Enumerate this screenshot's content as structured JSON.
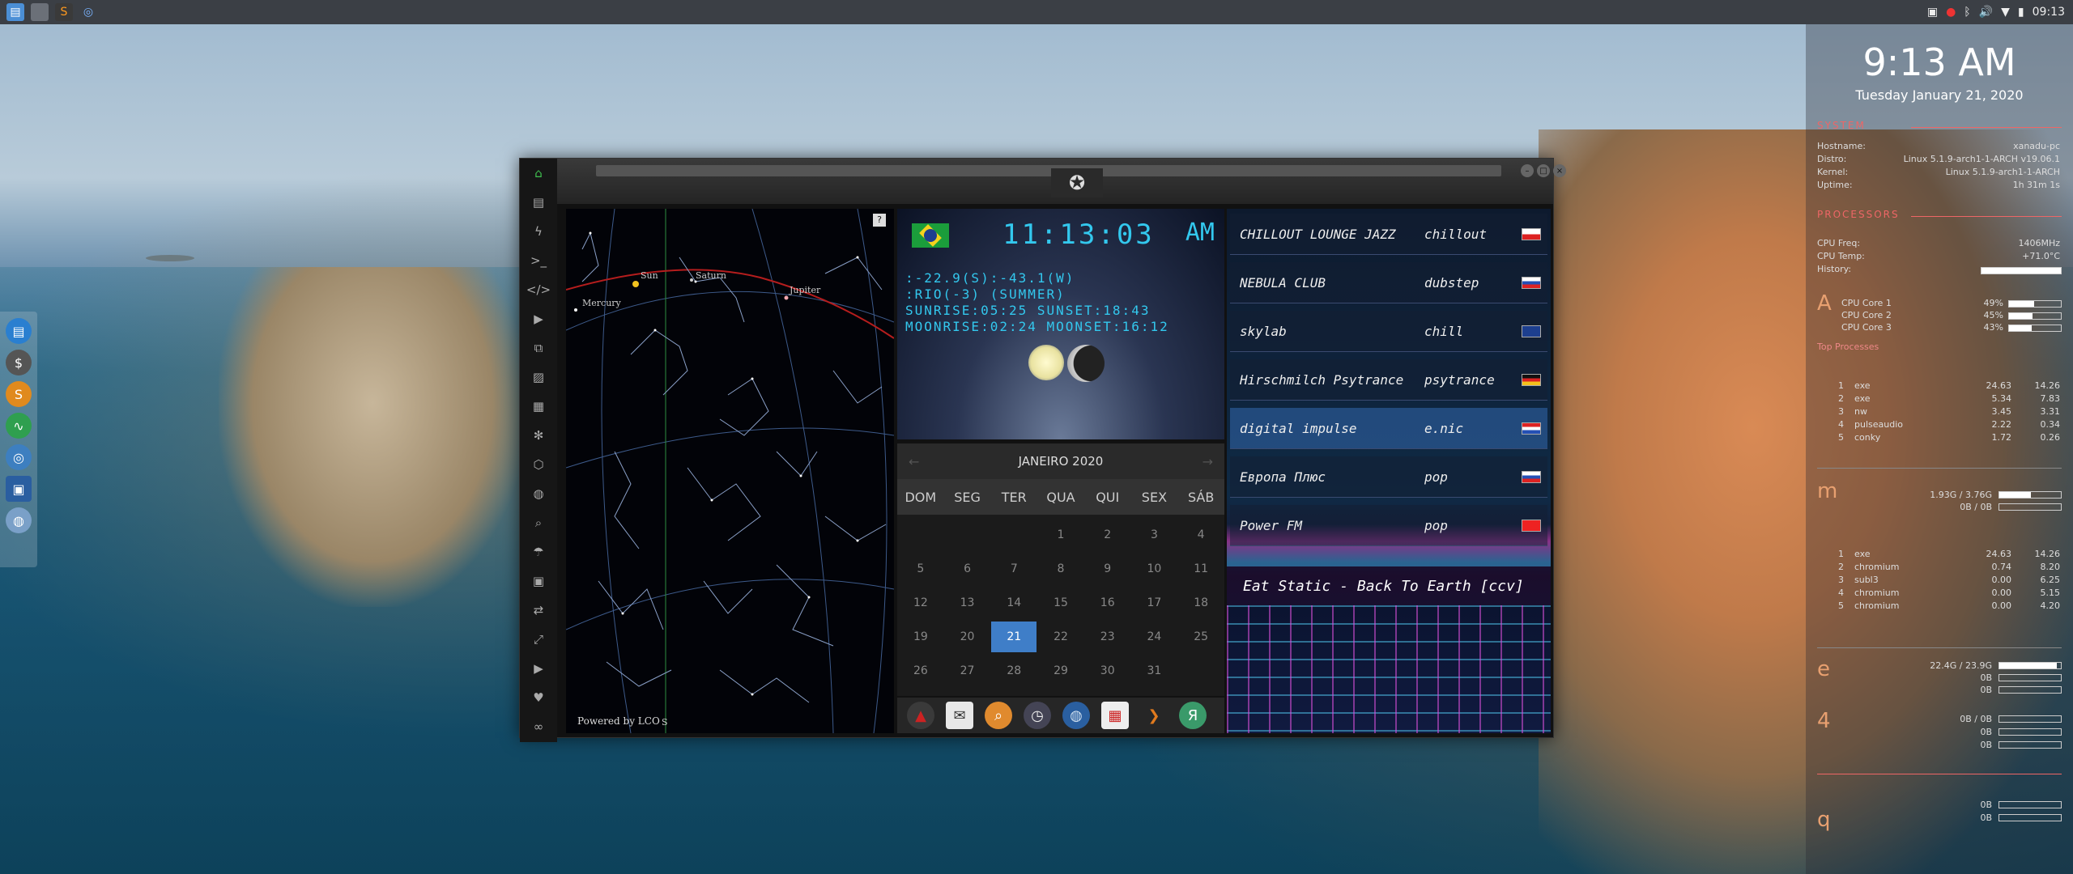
{
  "topbar": {
    "tray_time": "09:13",
    "left_icons": [
      "files-icon",
      "blank-icon",
      "sublime-icon",
      "chrome-icon"
    ]
  },
  "left_dock": {
    "icons": [
      "files-icon",
      "money-icon",
      "s-icon",
      "pulse-icon",
      "chrome-icon",
      "screenshot-icon",
      "globe-icon"
    ]
  },
  "conky": {
    "time": "9:13 AM",
    "date": "Tuesday January 21, 2020",
    "system": {
      "heading": "SYSTEM",
      "rows": [
        {
          "label": "Hostname:",
          "value": "xanadu-pc"
        },
        {
          "label": "Distro:",
          "value": "Linux 5.1.9-arch1-1-ARCH v19.06.1"
        },
        {
          "label": "Kernel:",
          "value": "Linux 5.1.9-arch1-1-ARCH"
        },
        {
          "label": "Uptime:",
          "value": "1h 31m 1s"
        }
      ]
    },
    "processors": {
      "heading": "PROCESSORS",
      "rows": [
        {
          "label": "CPU Freq:",
          "value": "1406MHz"
        },
        {
          "label": "CPU Temp:",
          "value": "+71.0°C"
        },
        {
          "label": "History:",
          "value": ""
        }
      ],
      "cores": [
        {
          "label": "CPU Core 1",
          "value": "49%",
          "pct": 49
        },
        {
          "label": "CPU Core 2",
          "value": "45%",
          "pct": 45
        },
        {
          "label": "CPU Core 3",
          "value": "43%",
          "pct": 43
        }
      ],
      "top_heading": "Top Processes",
      "top": [
        {
          "n": "1",
          "name": "exe",
          "a": "24.63",
          "b": "14.26"
        },
        {
          "n": "2",
          "name": "exe",
          "a": "5.34",
          "b": "7.83"
        },
        {
          "n": "3",
          "name": "nw",
          "a": "3.45",
          "b": "3.31"
        },
        {
          "n": "4",
          "name": "pulseaudio",
          "a": "2.22",
          "b": "0.34"
        },
        {
          "n": "5",
          "name": "conky",
          "a": "1.72",
          "b": "0.26"
        }
      ]
    },
    "memory": {
      "big": "m",
      "ram": "1.93G / 3.76G",
      "swap": "0B / 0B",
      "ram_pct": 51,
      "top": [
        {
          "n": "1",
          "name": "exe",
          "a": "24.63",
          "b": "14.26"
        },
        {
          "n": "2",
          "name": "chromium",
          "a": "0.74",
          "b": "8.20"
        },
        {
          "n": "3",
          "name": "subl3",
          "a": "0.00",
          "b": "6.25"
        },
        {
          "n": "4",
          "name": "chromium",
          "a": "0.00",
          "b": "5.15"
        },
        {
          "n": "5",
          "name": "chromium",
          "a": "0.00",
          "b": "4.20"
        }
      ]
    },
    "storage": {
      "big": "e",
      "root": "22.4G / 23.9G",
      "root_pct": 94,
      "rows": [
        "0B",
        "0B"
      ]
    },
    "network": {
      "big": "4",
      "rows": [
        "0B / 0B",
        "0B",
        "0B"
      ]
    },
    "misc": {
      "big": "q",
      "rows": [
        "0B",
        "0B"
      ]
    }
  },
  "window": {
    "sidebar_icons": [
      "home-icon",
      "document-icon",
      "lightning-icon",
      "terminal-icon",
      "code-icon",
      "play-icon",
      "copy-icon",
      "image-icon",
      "news-icon",
      "asterisk-icon",
      "hexagon-icon",
      "globe-icon",
      "search-icon",
      "umbrella-icon",
      "contact-icon",
      "arrows-icon",
      "expand-icon",
      "youtube-icon",
      "heart-icon",
      "link-icon"
    ],
    "controls": [
      "minimize",
      "maximize",
      "close"
    ]
  },
  "skymap": {
    "help": "?",
    "powered": "Powered by LCO",
    "south_label": "S",
    "planets": [
      {
        "name": "Mercury"
      },
      {
        "name": "Sun"
      },
      {
        "name": "Saturn"
      },
      {
        "name": "Jupiter"
      }
    ]
  },
  "clock_widget": {
    "time": "11:13:03",
    "ampm": "AM",
    "coords": ":-22.9(S):-43.1(W)",
    "location": ":RIO(-3) (SUMMER)",
    "sun": "SUNRISE:05:25 SUNSET:18:43",
    "moon": "MOONRISE:02:24 MOONSET:16:12"
  },
  "calendar": {
    "month": "JANEIRO 2020",
    "prev": "←",
    "next": "→",
    "days": [
      "DOM",
      "SEG",
      "TER",
      "QUA",
      "QUI",
      "SEX",
      "SÁB"
    ],
    "cells": [
      "",
      "",
      "",
      "1",
      "2",
      "3",
      "4",
      "5",
      "6",
      "7",
      "8",
      "9",
      "10",
      "11",
      "12",
      "13",
      "14",
      "15",
      "16",
      "17",
      "18",
      "19",
      "20",
      "21",
      "22",
      "23",
      "24",
      "25",
      "26",
      "27",
      "28",
      "29",
      "30",
      "31",
      ""
    ],
    "today": "21"
  },
  "taskbar": {
    "icons": [
      "caret-up-icon",
      "mail-icon",
      "search-icon",
      "clock-icon",
      "globe-icon",
      "calendar-icon",
      "arrow-right-icon",
      "yandex-icon"
    ]
  },
  "radio": {
    "stations": [
      {
        "name": "CHILLOUT LOUNGE JAZZ",
        "genre": "chillout",
        "flag": "pl"
      },
      {
        "name": "NEBULA CLUB",
        "genre": "dubstep",
        "flag": "ru"
      },
      {
        "name": "skylab",
        "genre": "chill",
        "flag": "uk"
      },
      {
        "name": "Hirschmilch Psytrance",
        "genre": "psytrance",
        "flag": "de"
      },
      {
        "name": "digital impulse",
        "genre": "e.nic",
        "flag": "hr"
      },
      {
        "name": "Европа Плюс",
        "genre": "pop",
        "flag": "ru"
      },
      {
        "name": "Power FM",
        "genre": "pop",
        "flag": "tr"
      }
    ],
    "now_playing": "Eat Static - Back To Earth [ccv]"
  }
}
